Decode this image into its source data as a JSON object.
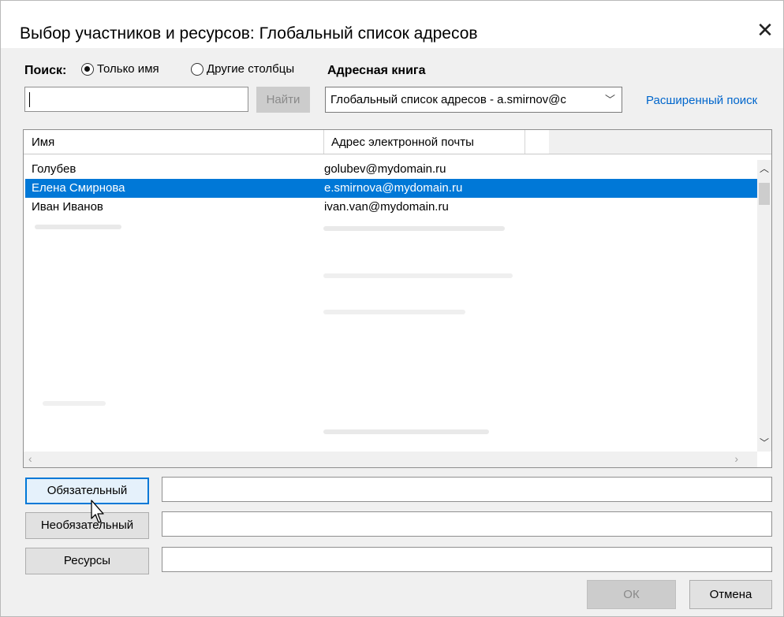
{
  "window": {
    "title": "Выбор участников и ресурсов: Глобальный список адресов",
    "close_glyph": "✕"
  },
  "search": {
    "label": "Поиск:",
    "options": [
      {
        "label": "Только имя",
        "checked": true
      },
      {
        "label": "Другие столбцы",
        "checked": false
      }
    ],
    "input_value": "",
    "find_button": "Найти"
  },
  "address_book": {
    "label": "Адресная книга",
    "selected": "Глобальный список адресов - a.smirnov@c",
    "advanced_search": "Расширенный поиск"
  },
  "table": {
    "columns": [
      "Имя",
      "Адрес электронной почты"
    ],
    "rows": [
      {
        "name": "Голубев",
        "email": "golubev@mydomain.ru",
        "selected": false
      },
      {
        "name": "Елена Смирнова",
        "email": "e.smirnova@mydomain.ru",
        "selected": true
      },
      {
        "name": "Иван Иванов",
        "email": "ivan.van@mydomain.ru",
        "selected": false
      }
    ]
  },
  "roles": [
    {
      "label": "Обязательный",
      "value": ""
    },
    {
      "label": "Необязательный",
      "value": ""
    },
    {
      "label": "Ресурсы",
      "value": ""
    }
  ],
  "footer": {
    "ok": "ОК",
    "cancel": "Отмена"
  },
  "icons": {
    "close": "close-icon",
    "chevron": "chevron-down-icon",
    "scroll_up": "chevron-up-icon",
    "scroll_down": "chevron-down-icon",
    "scroll_left": "chevron-left-icon",
    "scroll_right": "chevron-right-icon"
  },
  "colors": {
    "selection": "#0078d7",
    "link": "#0066cc"
  }
}
